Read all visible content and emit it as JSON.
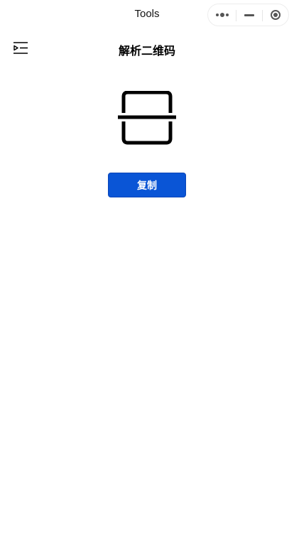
{
  "navbar": {
    "title": "Tools",
    "capsule": {
      "more_icon": "more-dots-icon",
      "minimize_icon": "minimize-icon",
      "close_icon": "target-circle-icon"
    }
  },
  "header": {
    "menu_icon": "menu-indent-icon",
    "title": "解析二维码"
  },
  "main": {
    "scan_icon": "scan-icon",
    "copy_button_label": "复制"
  },
  "colors": {
    "primary_button": "#0a55d6",
    "background": "#ffffff",
    "text": "#000000"
  }
}
